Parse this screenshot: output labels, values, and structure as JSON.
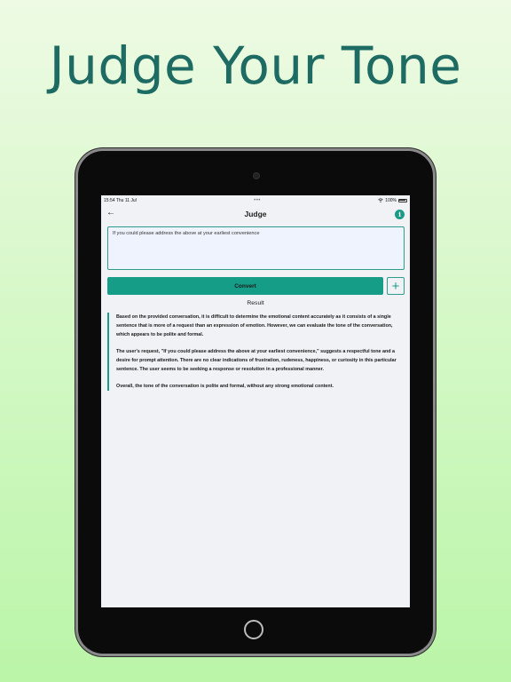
{
  "headline": "Judge Your Tone",
  "status_bar": {
    "time": "15:54",
    "date": "Thu 11 Jul",
    "dots": "•••",
    "battery": "100%"
  },
  "nav": {
    "title": "Judge",
    "back_icon": "arrow-left-icon",
    "info_icon": "info-icon"
  },
  "input": {
    "value": "If you could please address the above at your earliest convenience"
  },
  "actions": {
    "convert_label": "Convert",
    "plus_label": "+"
  },
  "result": {
    "label": "Result",
    "paragraphs": [
      "Based on the provided conversation, it is difficult to determine the emotional content accurately as it consists of a single sentence that is more of a request than an expression of emotion. However, we can evaluate the tone of the conversation, which appears to be polite and formal.",
      "The user's request, \"If you could please address the above at your earliest convenience,\" suggests a respectful tone and a desire for prompt attention. There are no clear indications of frustration, rudeness, happiness, or curiosity in this particular sentence. The user seems to be seeking a response or resolution in a professional manner.",
      "Overall, the tone of the conversation is polite and formal, without any strong emotional content."
    ]
  },
  "colors": {
    "accent": "#1a9b85",
    "headline": "#1d6b62",
    "background_top": "#eefae4",
    "background_bottom": "#baf5a8"
  }
}
